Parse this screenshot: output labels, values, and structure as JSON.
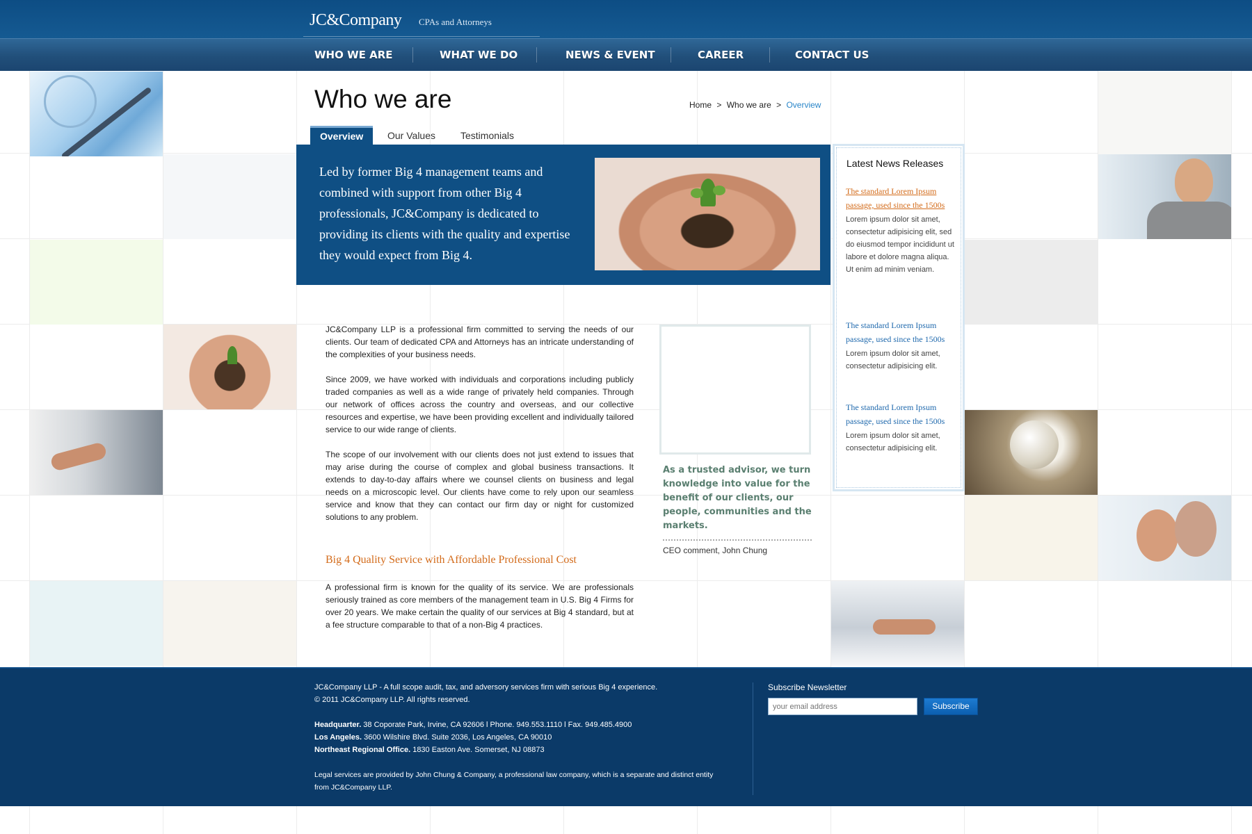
{
  "header": {
    "logo": "JC&Company",
    "tagline": "CPAs and Attorneys"
  },
  "nav": {
    "items": [
      {
        "label": "WHO WE ARE"
      },
      {
        "label": "WHAT WE DO"
      },
      {
        "label": "NEWS & EVENT"
      },
      {
        "label": "CAREER"
      },
      {
        "label": "CONTACT US"
      }
    ]
  },
  "page": {
    "title": "Who we are"
  },
  "breadcrumb": {
    "home": "Home",
    "sep1": ">",
    "section": "Who we are",
    "sep2": ">",
    "current": "Overview"
  },
  "tabs": [
    {
      "label": "Overview",
      "active": true
    },
    {
      "label": "Our Values",
      "active": false
    },
    {
      "label": "Testimonials",
      "active": false
    }
  ],
  "hero": {
    "text": "Led by former Big 4 management teams and combined with support from other Big 4 professionals, JC&Company is dedicated to providing its clients with the quality and expertise they would expect from Big 4."
  },
  "body": {
    "paragraphs": [
      "JC&Company LLP is a professional firm committed to serving the needs of our clients. Our team of dedicated CPA and Attorneys has an intricate understanding of the complexities of your business needs.",
      "Since 2009, we have worked with individuals and corporations including publicly traded companies as well as a wide range of privately held companies. Through our network of offices across the country and overseas, and our collective resources and expertise, we have been providing excellent and individually tailored service to our wide range of clients.",
      "The scope of our involvement with our clients does not just extend to issues that may arise during the course of complex and global business transactions. It extends to day-to-day affairs where we counsel clients on business and legal needs on a microscopic level. Our clients have come to rely upon our seamless service and know that they can contact our firm day or night for customized solutions to any problem."
    ],
    "subheading": "Big 4 Quality Service with Affordable Professional Cost",
    "paragraph2": "A professional firm is known for the quality of its service. We are professionals seriously trained as core members of the management team in U.S. Big 4 Firms for over 20 years. We make certain the quality of our services at Big 4 standard, but at a fee structure comparable to that of a non-Big 4 practices."
  },
  "ceo": {
    "quote": "As a trusted advisor, we turn knowledge into value for the benefit of our clients, our people, communities and the markets.",
    "caption": "CEO comment, John Chung"
  },
  "news": {
    "title": "Latest News Releases",
    "items": [
      {
        "headline": "The standard Lorem Ipsum passage, used since the 1500s",
        "desc": "Lorem ipsum dolor sit amet, consectetur adipisicing elit, sed do eiusmod tempor incididunt ut labore et dolore magna aliqua. Ut enim ad minim veniam."
      },
      {
        "headline": "The standard Lorem Ipsum passage, used since the 1500s",
        "desc": "Lorem ipsum dolor sit amet, consectetur adipisicing elit."
      },
      {
        "headline": "The standard Lorem Ipsum passage, used since the 1500s",
        "desc": "Lorem ipsum dolor sit amet, consectetur adipisicing elit."
      }
    ]
  },
  "footer": {
    "line1": "JC&Company LLP - A full scope audit, tax, and adversory services firm with serious Big 4 experience.",
    "line2": "© 2011 JC&Company LLP.  All rights reserved.",
    "hq_label": "Headquarter.",
    "hq_text": " 38 Coporate Park, Irvine, CA 92606  l  Phone. 949.553.1110  l  Fax. 949.485.4900",
    "la_label": "Los Angeles.",
    "la_text": " 3600 Wilshire Blvd. Suite 2036, Los Angeles, CA 90010",
    "ne_label": "Northeast Regional Office.",
    "ne_text": " 1830 Easton Ave. Somerset, NJ 08873",
    "legal": "Legal services are provided by John Chung & Company, a professional law company, which is a separate and distinct entity from JC&Company LLP.",
    "subscribe_title": "Subscribe Newsletter",
    "subscribe_placeholder": "your email address",
    "subscribe_button": "Subscribe"
  },
  "colors": {
    "brand_blue": "#0f4f84",
    "nav_blue": "#214f7a",
    "accent_orange": "#d36b1a",
    "link_blue": "#1f69ad",
    "footer_blue": "#0b3a68"
  }
}
